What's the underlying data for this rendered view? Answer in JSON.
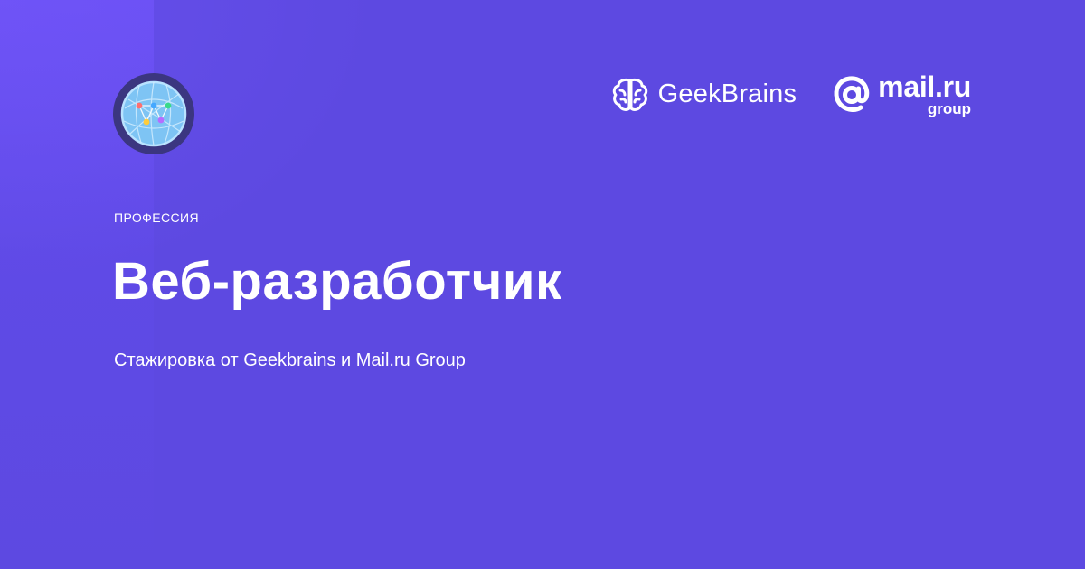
{
  "header": {
    "badge_icon": "globe-network-icon",
    "partners": {
      "geekbrains": {
        "icon": "brain-icon",
        "label": "GeekBrains"
      },
      "mailru": {
        "icon": "at-sign-icon",
        "label": "mail.ru",
        "sublabel": "group"
      }
    }
  },
  "hero": {
    "eyebrow": "ПРОФЕССИЯ",
    "title": "Веб-разработчик",
    "subtitle": "Стажировка от Geekbrains и Mail.ru Group"
  },
  "colors": {
    "background": "#5d49e1",
    "corner_accent": "#6a50f3",
    "badge_ring": "#3b3680",
    "badge_fill": "#6fb8ee",
    "text": "#ffffff"
  }
}
